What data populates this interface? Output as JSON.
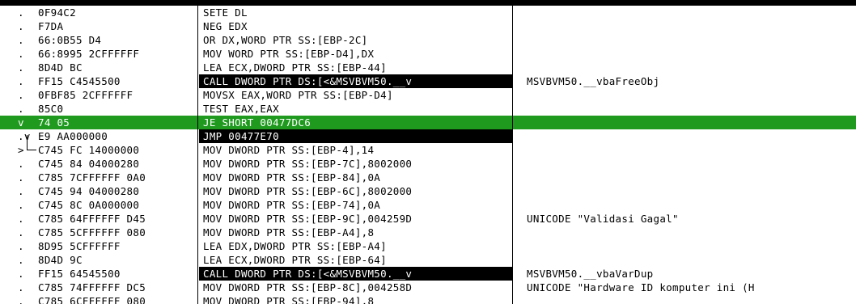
{
  "rows": [
    {
      "mark": ".",
      "hex": "0F94C2",
      "asm": "SETE DL",
      "comment": ""
    },
    {
      "mark": ".",
      "hex": "F7DA",
      "asm": "NEG EDX",
      "comment": ""
    },
    {
      "mark": ".",
      "hex": "66:0B55 D4",
      "asm": "OR DX,WORD PTR SS:[EBP-2C]",
      "comment": ""
    },
    {
      "mark": ".",
      "hex": "66:8995 2CFFFFFF",
      "asm": "MOV WORD PTR SS:[EBP-D4],DX",
      "comment": ""
    },
    {
      "mark": ".",
      "hex": "8D4D BC",
      "asm": "LEA ECX,DWORD PTR SS:[EBP-44]",
      "comment": ""
    },
    {
      "mark": ".",
      "hex": "FF15 C4545500",
      "asm": "CALL DWORD PTR DS:[<&MSVBVM50.__v",
      "comment": "MSVBVM50.__vbaFreeObj"
    },
    {
      "mark": ".",
      "hex": "0FBF85 2CFFFFFF",
      "asm": "MOVSX EAX,WORD PTR SS:[EBP-D4]",
      "comment": ""
    },
    {
      "mark": ".",
      "hex": "85C0",
      "asm": "TEST EAX,EAX",
      "comment": ""
    },
    {
      "mark": "v",
      "hex": "74 05",
      "asm": "JE SHORT 00477DC6",
      "comment": ""
    },
    {
      "mark": ".v",
      "hex": "E9 AA000000",
      "asm": "JMP 00477E70",
      "comment": ""
    },
    {
      "mark": ">",
      "hex": "C745 FC 14000000",
      "asm": "MOV DWORD PTR SS:[EBP-4],14",
      "comment": ""
    },
    {
      "mark": ".",
      "hex": "C745 84 04000280",
      "asm": "MOV DWORD PTR SS:[EBP-7C],8002000",
      "comment": ""
    },
    {
      "mark": ".",
      "hex": "C785 7CFFFFFF 0A0",
      "asm": "MOV DWORD PTR SS:[EBP-84],0A",
      "comment": ""
    },
    {
      "mark": ".",
      "hex": "C745 94 04000280",
      "asm": "MOV DWORD PTR SS:[EBP-6C],8002000",
      "comment": ""
    },
    {
      "mark": ".",
      "hex": "C745 8C 0A000000",
      "asm": "MOV DWORD PTR SS:[EBP-74],0A",
      "comment": ""
    },
    {
      "mark": ".",
      "hex": "C785 64FFFFFF D45",
      "asm": "MOV DWORD PTR SS:[EBP-9C],004259D",
      "comment": "UNICODE \"Validasi Gagal\""
    },
    {
      "mark": ".",
      "hex": "C785 5CFFFFFF 080",
      "asm": "MOV DWORD PTR SS:[EBP-A4],8",
      "comment": ""
    },
    {
      "mark": ".",
      "hex": "8D95 5CFFFFFF",
      "asm": "LEA EDX,DWORD PTR SS:[EBP-A4]",
      "comment": ""
    },
    {
      "mark": ".",
      "hex": "8D4D 9C",
      "asm": "LEA ECX,DWORD PTR SS:[EBP-64]",
      "comment": ""
    },
    {
      "mark": ".",
      "hex": "FF15 64545500",
      "asm": "CALL DWORD PTR DS:[<&MSVBVM50.__v",
      "comment": "MSVBVM50.__vbaVarDup"
    },
    {
      "mark": ".",
      "hex": "C785 74FFFFFF DC5",
      "asm": "MOV DWORD PTR SS:[EBP-8C],004258D",
      "comment": "UNICODE \"Hardware ID komputer ini (H"
    },
    {
      "mark": ".",
      "hex": "C785 6CFFFFFF 080",
      "asm": "MOV DWORD PTR SS:[EBP-94],8",
      "comment": ""
    }
  ]
}
